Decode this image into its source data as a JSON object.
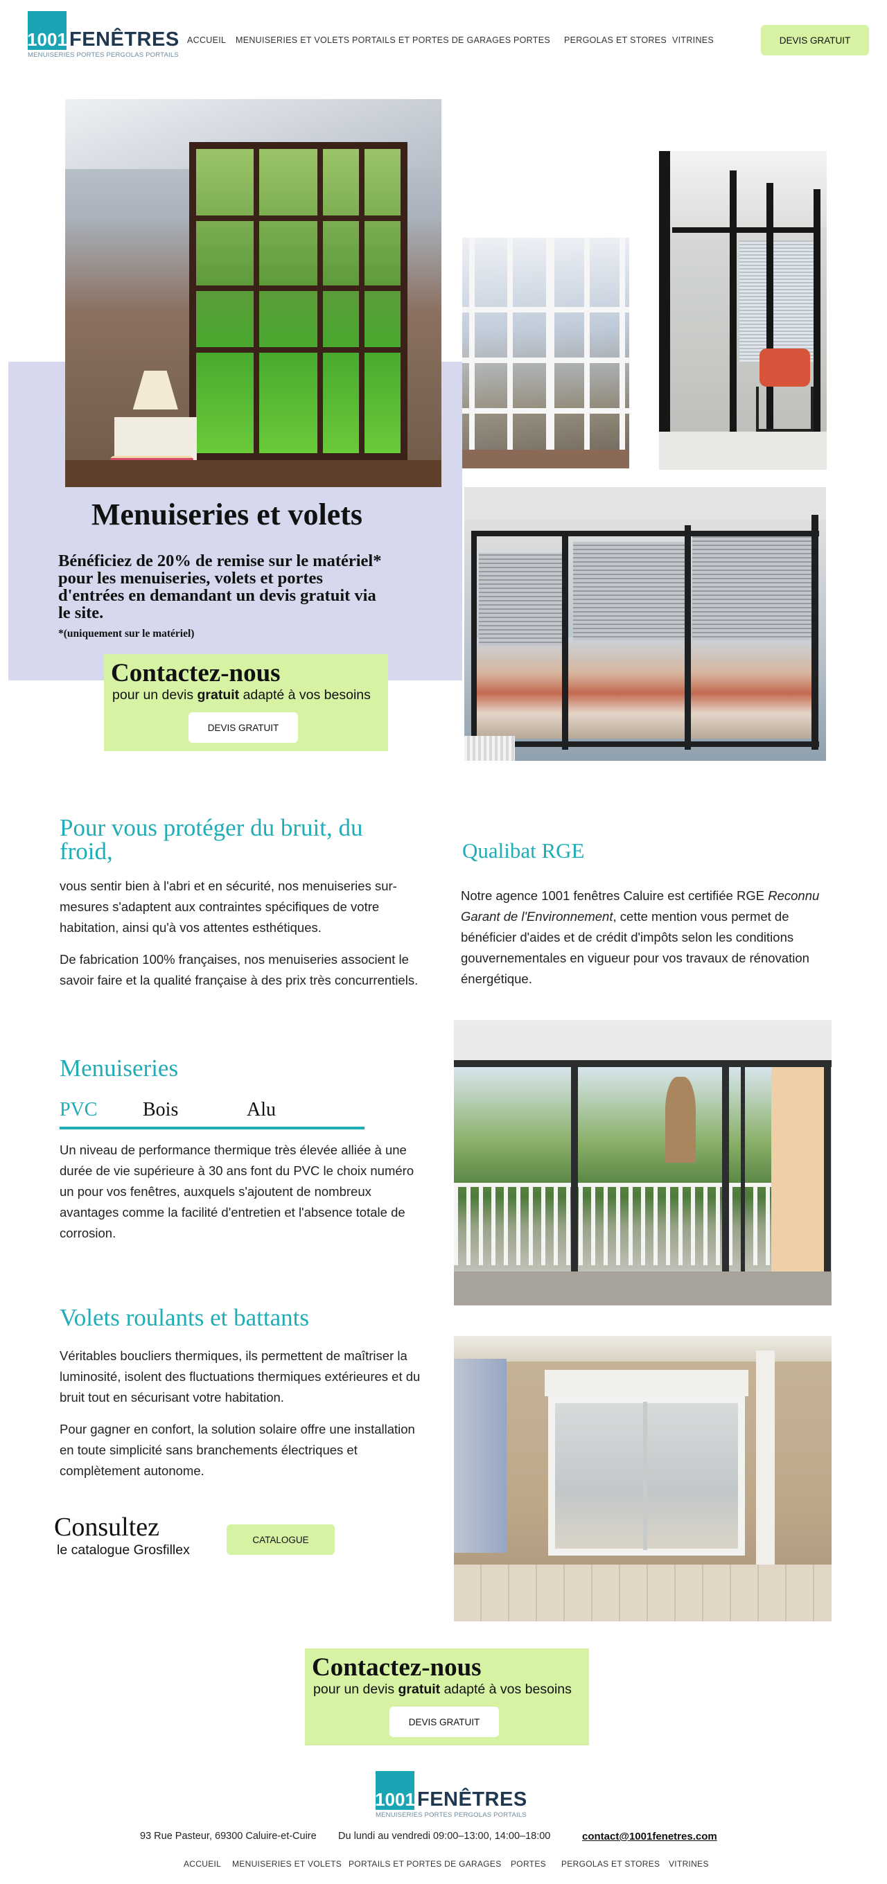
{
  "header": {
    "logo_number": "1001",
    "logo_word": "FENÊTRES",
    "logo_tagline": "MENUISERIES PORTES PERGOLAS PORTAILS",
    "nav": [
      "ACCUEIL",
      "MENUISERIES ET VOLETS",
      "PORTAILS ET PORTES DE GARAGES",
      "PORTES",
      "PERGOLAS ET STORES",
      "VITRINES"
    ],
    "cta": "DEVIS GRATUIT"
  },
  "hero": {
    "title": "Menuiseries et volets",
    "promo": "Bénéficiez de 20% de remise sur le matériel* pour les menuiseries, volets et portes d'entrées en demandant un devis gratuit via le site.",
    "footnote": "*(uniquement sur le matériel)",
    "contact": {
      "title": "Contactez-nous",
      "subtitle_before": "pour un devis ",
      "subtitle_bold": "gratuit",
      "subtitle_after": " adapté à vos besoins",
      "button": "DEVIS GRATUIT"
    }
  },
  "protect": {
    "title": "Pour vous protéger du bruit, du froid,",
    "p1": "vous sentir bien à l'abri et en sécurité, nos menuiseries sur-mesures s'adaptent aux contraintes spécifiques de votre habitation, ainsi qu'à vos attentes esthétiques.",
    "p2": "De fabrication 100% françaises, nos menuiseries associent le savoir faire et la qualité française à des prix très concurrentiels."
  },
  "qualibat": {
    "title": "Qualibat RGE",
    "p_before": "Notre agence 1001 fenêtres Caluire est certifiée RGE ",
    "p_italic": "Reconnu Garant de l'Environnement",
    "p_after": ", cette mention vous permet de bénéficier d'aides et de crédit d'impôts selon les conditions gouvernementales en vigueur pour vos travaux de rénovation énergétique."
  },
  "menuiseries": {
    "title": "Menuiseries",
    "tabs": [
      "PVC",
      "Bois",
      "Alu"
    ],
    "active_tab": "PVC",
    "text": "Un niveau de performance thermique très élevée alliée à une durée de vie supérieure à 30 ans font du PVC  le choix numéro un pour vos fenêtres, auxquels s'ajoutent de nombreux avantages comme la facilité d'entretien et l'absence totale de corrosion."
  },
  "volets": {
    "title": "Volets roulants et battants",
    "p1": "Véritables boucliers thermiques, ils permettent de maîtriser la luminosité, isolent des fluctuations thermiques extérieures et du bruit tout en sécurisant votre habitation.",
    "p2": "Pour gagner en confort, la solution solaire offre une installation en toute simplicité sans branchements électriques et complètement autonome."
  },
  "catalogue": {
    "title": "Consultez",
    "subtitle": "le catalogue Grosfillex",
    "button": "CATALOGUE"
  },
  "contact2": {
    "title": "Contactez-nous",
    "subtitle_before": "pour un devis ",
    "subtitle_bold": "gratuit",
    "subtitle_after": " adapté à vos besoins",
    "button": "DEVIS GRATUIT"
  },
  "footer": {
    "logo_number": "1001",
    "logo_word": "FENÊTRES",
    "logo_tagline": "MENUISERIES PORTES PERGOLAS PORTAILS",
    "address": "93 Rue Pasteur, 69300 Caluire-et-Cuire",
    "hours": "Du lundi au vendredi 09:00–13:00, 14:00–18:00",
    "email": "contact@1001fenetres.com",
    "nav": [
      "ACCUEIL",
      "MENUISERIES ET VOLETS",
      "PORTAILS ET PORTES DE GARAGES",
      "PORTES",
      "PERGOLAS ET STORES",
      "VITRINES"
    ]
  },
  "colors": {
    "brand_teal": "#1aa5b5",
    "accent_green": "#d6f2a3",
    "hero_lavender": "#d6d8ed"
  }
}
